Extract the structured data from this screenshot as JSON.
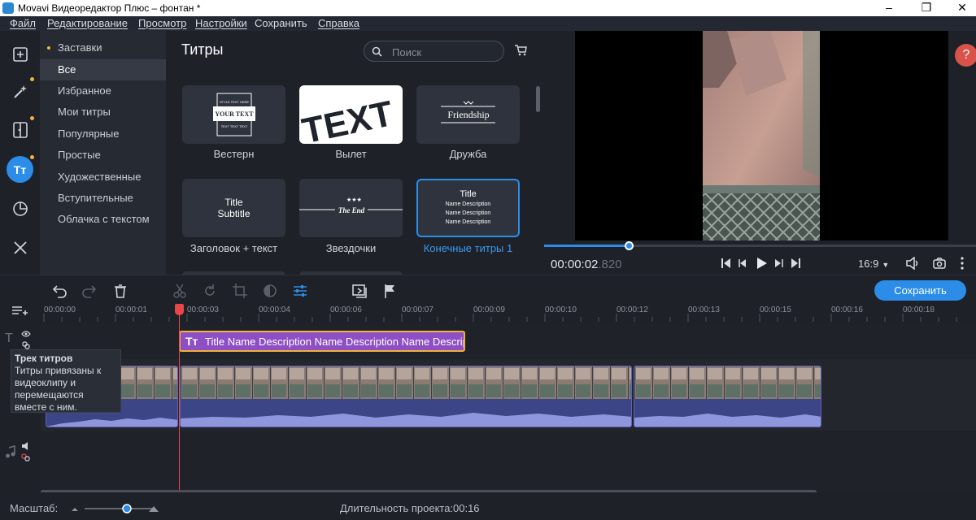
{
  "window": {
    "title": "Movavi Видеоредактор Плюс – фонтан *"
  },
  "menu": [
    "Файл",
    "Редактирование",
    "Просмотр",
    "Настройки",
    "Сохранить",
    "Справка"
  ],
  "rail": [
    {
      "icon": "add-media-icon"
    },
    {
      "icon": "magic-wand-icon"
    },
    {
      "icon": "transitions-icon"
    },
    {
      "icon": "titles-icon",
      "label": "Tт"
    },
    {
      "icon": "stickers-icon"
    },
    {
      "icon": "tools-icon"
    }
  ],
  "categories": [
    "Заставки",
    "Все",
    "Избранное",
    "Мои титры",
    "Популярные",
    "Простые",
    "Художественные",
    "Вступительные",
    "Облачка с текстом"
  ],
  "grid": {
    "title": "Титры",
    "search_placeholder": "Поиск",
    "items": [
      {
        "label": "Вестерн",
        "art": [
          "STYLE TEXT HERE",
          "YOUR TEXT",
          "TEXT TEXT TEXT"
        ]
      },
      {
        "label": "Вылет",
        "art": [
          "TEXT"
        ]
      },
      {
        "label": "Дружба",
        "art": [
          "Friendship"
        ]
      },
      {
        "label": "Заголовок + текст",
        "art": [
          "Title",
          "Subtitle"
        ]
      },
      {
        "label": "Звездочки",
        "art": [
          "The End"
        ]
      },
      {
        "label": "Конечные титры 1",
        "art": [
          "Title",
          "Name Description",
          "Name Description",
          "Name Description"
        ]
      }
    ]
  },
  "preview": {
    "time_main": "00:00:02",
    "time_ms": ".820",
    "aspect": "16:9",
    "help": "?",
    "progress": 0.195
  },
  "toolbar": {
    "save_label": "Сохранить"
  },
  "ruler": [
    "00:00:00",
    "00:00:01",
    "00:00:03",
    "00:00:04",
    "00:00:06",
    "00:00:07",
    "00:00:09",
    "00:00:10",
    "00:00:12",
    "00:00:13",
    "00:00:15",
    "00:00:16",
    "00:00:18"
  ],
  "title_clip": {
    "text": "Title Name Description Name Description Name Descriptio"
  },
  "tooltip": {
    "heading": "Трек титров",
    "body": "Титры привязаны к видеоклипу и перемещаются вместе с ним."
  },
  "bottom": {
    "scale_label": "Масштаб:",
    "duration_label": "Длительность проекта:",
    "duration": "00:16"
  },
  "colors": {
    "accent": "#2b8de8",
    "playhead": "#e8474a",
    "title_clip": "#8e4fc4",
    "audio": "#8f97dc"
  }
}
